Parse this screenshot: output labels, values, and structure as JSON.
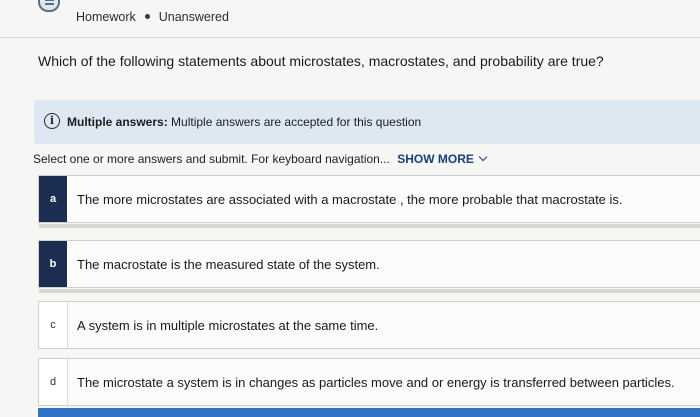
{
  "header": {
    "category": "Homework",
    "status": "Unanswered",
    "icon": "homework-icon"
  },
  "question": {
    "text": "Which of the following statements about microstates, macrostates, and probability are true?"
  },
  "info": {
    "icon": "info-icon",
    "label": "Multiple answers:",
    "text": "Multiple answers are accepted for this question"
  },
  "instructions": {
    "text": "Select one or more answers and submit. For keyboard navigation...",
    "show_more": "SHOW MORE"
  },
  "options": [
    {
      "letter": "a",
      "text": "The more microstates are associated with a macrostate , the more probable that macrostate is."
    },
    {
      "letter": "b",
      "text": "The macrostate is the measured state of the system."
    },
    {
      "letter": "c",
      "text": "A system is in multiple microstates at the same time."
    },
    {
      "letter": "d",
      "text": "The microstate a system is in changes as particles move and or energy is transferred between particles."
    }
  ],
  "colors": {
    "selected_letter_bg": "#1b2e52",
    "info_bg": "#dde8f2",
    "link": "#1b3f7a",
    "accent_bar": "#3173c7"
  }
}
